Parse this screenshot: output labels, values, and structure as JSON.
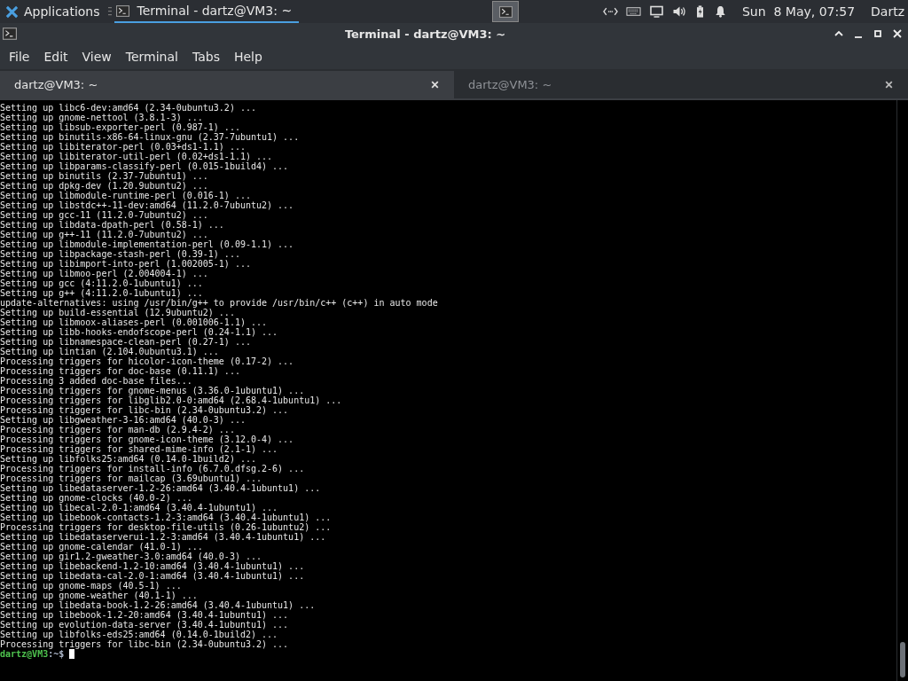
{
  "top_panel": {
    "applications": "Applications",
    "tasks": [
      {
        "label": "Terminal - dartz@VM3: ~",
        "selected": true
      }
    ],
    "clock": "Sun  8 May, 07:57",
    "user": "Dartz"
  },
  "window": {
    "title": "Terminal - dartz@VM3: ~",
    "menu": [
      "File",
      "Edit",
      "View",
      "Terminal",
      "Tabs",
      "Help"
    ],
    "tabs": [
      {
        "label": "dartz@VM3: ~",
        "selected": true
      },
      {
        "label": "dartz@VM3: ~",
        "selected": false
      }
    ],
    "lines": [
      "Setting up libc6-dev:amd64 (2.34-0ubuntu3.2) ...",
      "Setting up gnome-nettool (3.8.1-3) ...",
      "Setting up libsub-exporter-perl (0.987-1) ...",
      "Setting up binutils-x86-64-linux-gnu (2.37-7ubuntu1) ...",
      "Setting up libiterator-perl (0.03+ds1-1.1) ...",
      "Setting up libiterator-util-perl (0.02+ds1-1.1) ...",
      "Setting up libparams-classify-perl (0.015-1build4) ...",
      "Setting up binutils (2.37-7ubuntu1) ...",
      "Setting up dpkg-dev (1.20.9ubuntu2) ...",
      "Setting up libmodule-runtime-perl (0.016-1) ...",
      "Setting up libstdc++-11-dev:amd64 (11.2.0-7ubuntu2) ...",
      "Setting up gcc-11 (11.2.0-7ubuntu2) ...",
      "Setting up libdata-dpath-perl (0.58-1) ...",
      "Setting up g++-11 (11.2.0-7ubuntu2) ...",
      "Setting up libmodule-implementation-perl (0.09-1.1) ...",
      "Setting up libpackage-stash-perl (0.39-1) ...",
      "Setting up libimport-into-perl (1.002005-1) ...",
      "Setting up libmoo-perl (2.004004-1) ...",
      "Setting up gcc (4:11.2.0-1ubuntu1) ...",
      "Setting up g++ (4:11.2.0-1ubuntu1) ...",
      "update-alternatives: using /usr/bin/g++ to provide /usr/bin/c++ (c++) in auto mode",
      "Setting up build-essential (12.9ubuntu2) ...",
      "Setting up libmoox-aliases-perl (0.001006-1.1) ...",
      "Setting up libb-hooks-endofscope-perl (0.24-1.1) ...",
      "Setting up libnamespace-clean-perl (0.27-1) ...",
      "Setting up lintian (2.104.0ubuntu3.1) ...",
      "Processing triggers for hicolor-icon-theme (0.17-2) ...",
      "Processing triggers for doc-base (0.11.1) ...",
      "Processing 3 added doc-base files...",
      "Processing triggers for gnome-menus (3.36.0-1ubuntu1) ...",
      "Processing triggers for libglib2.0-0:amd64 (2.68.4-1ubuntu1) ...",
      "Processing triggers for libc-bin (2.34-0ubuntu3.2) ...",
      "Setting up libgweather-3-16:amd64 (40.0-3) ...",
      "Processing triggers for man-db (2.9.4-2) ...",
      "Processing triggers for gnome-icon-theme (3.12.0-4) ...",
      "Processing triggers for shared-mime-info (2.1-1) ...",
      "Setting up libfolks25:amd64 (0.14.0-1build2) ...",
      "Processing triggers for install-info (6.7.0.dfsg.2-6) ...",
      "Processing triggers for mailcap (3.69ubuntu1) ...",
      "Setting up libedataserver-1.2-26:amd64 (3.40.4-1ubuntu1) ...",
      "Setting up gnome-clocks (40.0-2) ...",
      "Setting up libecal-2.0-1:amd64 (3.40.4-1ubuntu1) ...",
      "Setting up libebook-contacts-1.2-3:amd64 (3.40.4-1ubuntu1) ...",
      "Processing triggers for desktop-file-utils (0.26-1ubuntu2) ...",
      "Setting up libedataserverui-1.2-3:amd64 (3.40.4-1ubuntu1) ...",
      "Setting up gnome-calendar (41.0-1) ...",
      "Setting up gir1.2-gweather-3.0:amd64 (40.0-3) ...",
      "Setting up libebackend-1.2-10:amd64 (3.40.4-1ubuntu1) ...",
      "Setting up libedata-cal-2.0-1:amd64 (3.40.4-1ubuntu1) ...",
      "Setting up gnome-maps (40.5-1) ...",
      "Setting up gnome-weather (40.1-1) ...",
      "Setting up libedata-book-1.2-26:amd64 (3.40.4-1ubuntu1) ...",
      "Setting up libebook-1.2-20:amd64 (3.40.4-1ubuntu1) ...",
      "Setting up evolution-data-server (3.40.4-1ubuntu1) ...",
      "Setting up libfolks-eds25:amd64 (0.14.0-1build2) ...",
      "Processing triggers for libc-bin (2.34-0ubuntu3.2) ..."
    ],
    "prompt": {
      "user_host": "dartz@VM3",
      "path": ":~$"
    }
  }
}
